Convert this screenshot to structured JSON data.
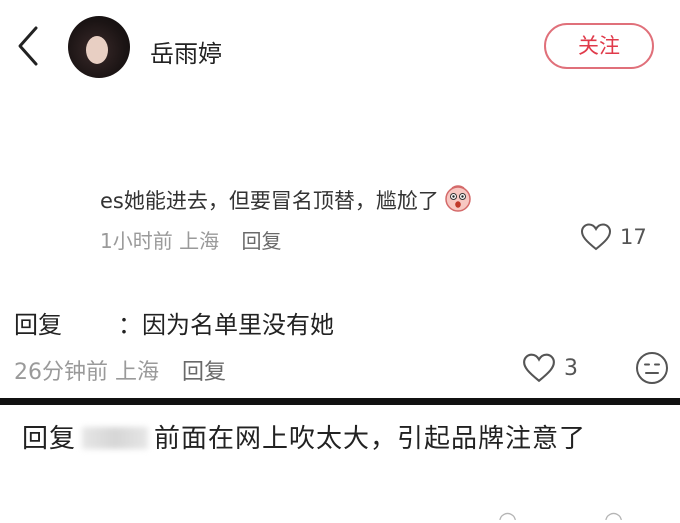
{
  "header": {
    "username": "岳雨婷",
    "follow_label": "关注"
  },
  "comment": {
    "text": "es她能进去，但要冒名顶替，尴尬了",
    "time": "1小时前",
    "location": "上海",
    "reply_label": "回复",
    "likes": "17"
  },
  "reply1": {
    "prefix": "回复",
    "text": "：因为名单里没有她",
    "time": "26分钟前",
    "location": "上海",
    "reply_label": "回复",
    "likes": "3"
  },
  "reply2": {
    "prefix": "回复",
    "text": "前面在网上吹太大，引起品牌注意了"
  },
  "colors": {
    "accent": "#e03a4a",
    "meta": "#9a9a9a"
  },
  "icons": [
    "back-arrow-icon",
    "heart-icon",
    "emoji-face-icon",
    "dislike-face-icon"
  ]
}
